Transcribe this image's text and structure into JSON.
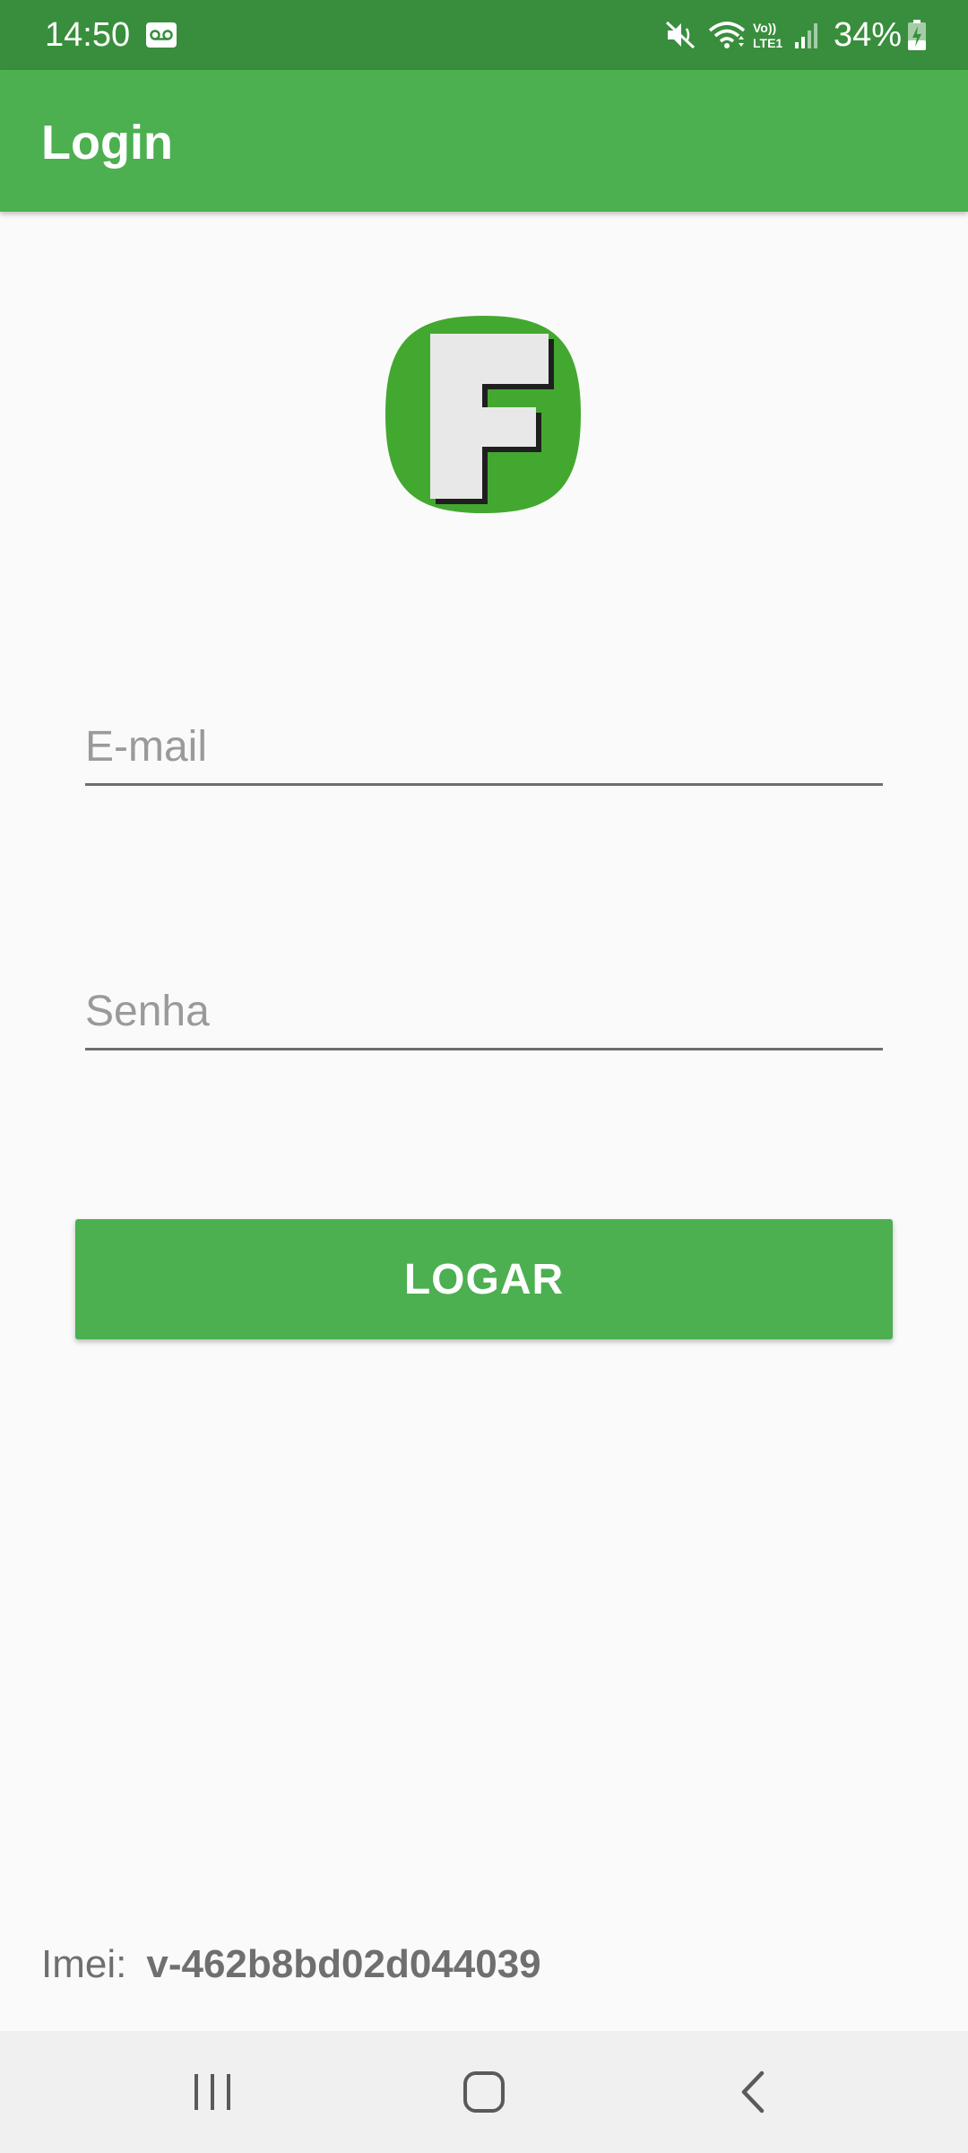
{
  "status_bar": {
    "time": "14:50",
    "battery": "34%",
    "network_label": "Vo)) LTE1",
    "icons": [
      "voicemail-icon",
      "mute-icon",
      "wifi-icon",
      "lte-icon",
      "signal-icon",
      "battery-charging-icon"
    ]
  },
  "app_bar": {
    "title": "Login"
  },
  "logo": {
    "letter": "F",
    "color": "#43a82f"
  },
  "form": {
    "email_placeholder": "E-mail",
    "email_value": "",
    "password_placeholder": "Senha",
    "password_value": "",
    "submit_label": "LOGAR"
  },
  "footer": {
    "imei_label": "Imei:",
    "imei_value": "v-462b8bd02d044039"
  },
  "nav_bar": {
    "icons": [
      "recents-icon",
      "home-icon",
      "back-icon"
    ]
  },
  "colors": {
    "primary": "#4caf50",
    "primary_dark": "#388e3c",
    "background": "#fafafa"
  }
}
